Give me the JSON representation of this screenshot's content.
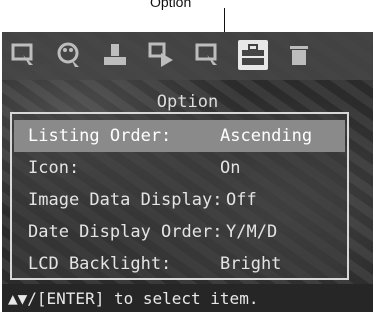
{
  "callout": {
    "label": "Option"
  },
  "toolbar": {
    "icons": [
      "magnify-icon",
      "palette-icon",
      "print-icon",
      "slideshow-icon",
      "magnify-icon",
      "toolbox-icon",
      "trash-icon"
    ],
    "active_index": 5
  },
  "menu": {
    "title": "Option",
    "items": [
      {
        "label": "Listing Order:",
        "value": "Ascending",
        "selected": true
      },
      {
        "label": "Icon:",
        "value": "On",
        "selected": false
      },
      {
        "label": "Image Data Display:",
        "value": "Off",
        "selected": false
      },
      {
        "label": "Date Display Order:",
        "value": "Y/M/D",
        "selected": false
      },
      {
        "label": "LCD Backlight:",
        "value": "Bright",
        "selected": false
      }
    ]
  },
  "status": {
    "hint": "▲▼/[ENTER] to select item."
  }
}
